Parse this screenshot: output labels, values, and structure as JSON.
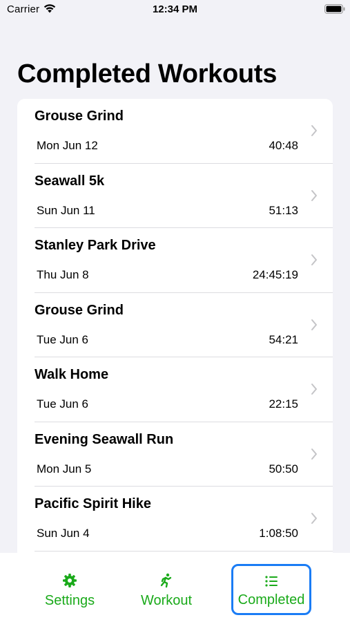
{
  "status_bar": {
    "carrier": "Carrier",
    "time": "12:34 PM",
    "wifi_icon": "wifi-icon",
    "battery_icon": "battery-icon"
  },
  "page": {
    "title": "Completed Workouts"
  },
  "workouts": [
    {
      "title": "Grouse Grind",
      "date": "Mon Jun 12",
      "duration": "40:48"
    },
    {
      "title": "Seawall 5k",
      "date": "Sun Jun 11",
      "duration": "51:13"
    },
    {
      "title": "Stanley Park Drive",
      "date": "Thu Jun 8",
      "duration": "24:45:19"
    },
    {
      "title": "Grouse Grind",
      "date": "Tue Jun 6",
      "duration": "54:21"
    },
    {
      "title": "Walk Home",
      "date": "Tue Jun 6",
      "duration": "22:15"
    },
    {
      "title": "Evening Seawall Run",
      "date": "Mon Jun 5",
      "duration": "50:50"
    },
    {
      "title": "Pacific Spirit Hike",
      "date": "Sun Jun 4",
      "duration": "1:08:50"
    }
  ],
  "tab_bar": {
    "tabs": [
      {
        "label": "Settings",
        "icon": "gear-icon"
      },
      {
        "label": "Workout",
        "icon": "running-figure-icon"
      },
      {
        "label": "Completed",
        "icon": "list-icon",
        "selected": true
      }
    ],
    "accent_color": "#1aaa1a",
    "selected_outline_color": "#1a7cf5"
  }
}
